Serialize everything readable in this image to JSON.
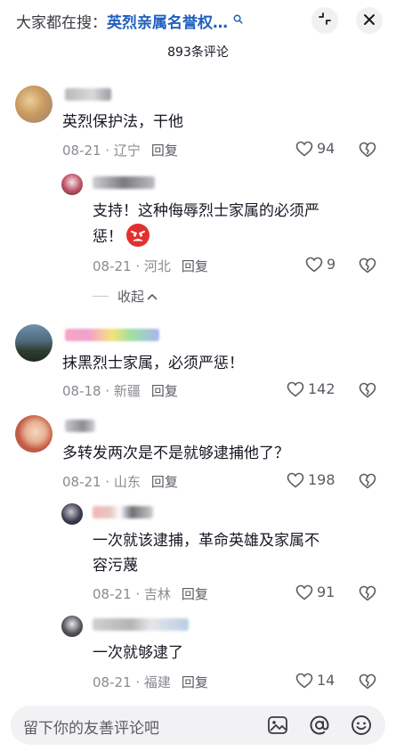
{
  "header": {
    "search_prefix": "大家都在搜：",
    "search_keyword": "英烈亲属名誉权…",
    "search_icon": "search-icon",
    "comment_count": "893条评论"
  },
  "comments": [
    {
      "text": "英烈保护法，干他",
      "date": "08-21",
      "location": "辽宁",
      "reply": "回复",
      "likes": "94",
      "replies": [
        {
          "text": "支持！这种侮辱烈士家属的必须严惩！",
          "text_line1": "支持！这种侮辱烈士家属的必须严",
          "text_line2": "惩！",
          "emoji": "angry-face-emoji",
          "date": "08-21",
          "location": "河北",
          "reply": "回复",
          "likes": "9"
        }
      ],
      "collapse_label": "收起"
    },
    {
      "text": "抹黑烈士家属，必须严惩！",
      "date": "08-18",
      "location": "新疆",
      "reply": "回复",
      "likes": "142"
    },
    {
      "text": "多转发两次是不是就够逮捕他了？",
      "date": "08-21",
      "location": "山东",
      "reply": "回复",
      "likes": "198",
      "replies": [
        {
          "text_line1": "一次就该逮捕，革命英雄及家属不",
          "text_line2": "容污蔑",
          "date": "08-21",
          "location": "吉林",
          "reply": "回复",
          "likes": "91"
        },
        {
          "text_line1": "一次就够逮了",
          "date": "08-21",
          "location": "福建",
          "reply": "回复",
          "likes": "14"
        }
      ]
    }
  ],
  "composer": {
    "placeholder": "留下你的友善评论吧",
    "image_icon": "image-icon",
    "mention_icon": "at-mention-icon",
    "emoji_icon": "smiley-emoji-icon"
  },
  "colors": {
    "keyword": "#1f5fbf",
    "meta": "#8a8b91",
    "text": "#161823",
    "emoji_red": "#e23030"
  }
}
